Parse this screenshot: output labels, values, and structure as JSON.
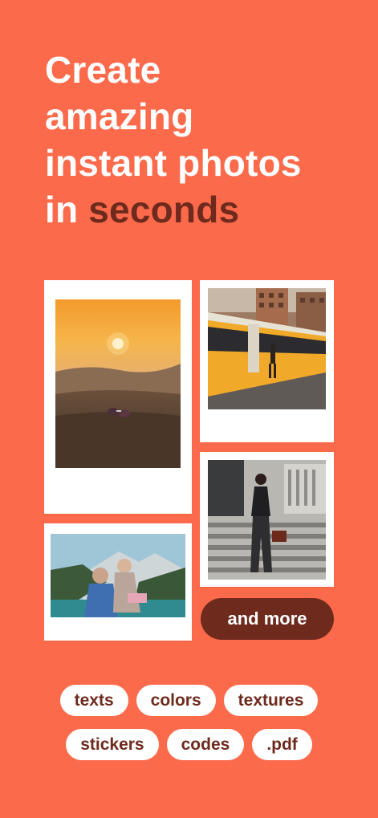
{
  "headline": {
    "line1": "Create",
    "line2": "amazing",
    "line3": "instant photos",
    "line4_prefix": "in ",
    "line4_accent": "seconds"
  },
  "colors": {
    "background": "#fb6a4a",
    "accent": "#6e2a1d",
    "card": "#ffffff"
  },
  "gallery": {
    "photos": [
      {
        "subject": "sunset-desert-photo"
      },
      {
        "subject": "yellow-tram-street-photo"
      },
      {
        "subject": "woman-on-steps-photo"
      },
      {
        "subject": "couple-mountain-lake-photo"
      }
    ]
  },
  "more_button": {
    "label": "and more"
  },
  "features": {
    "row1": [
      "texts",
      "colors",
      "textures"
    ],
    "row2": [
      "stickers",
      "codes",
      ".pdf"
    ]
  }
}
